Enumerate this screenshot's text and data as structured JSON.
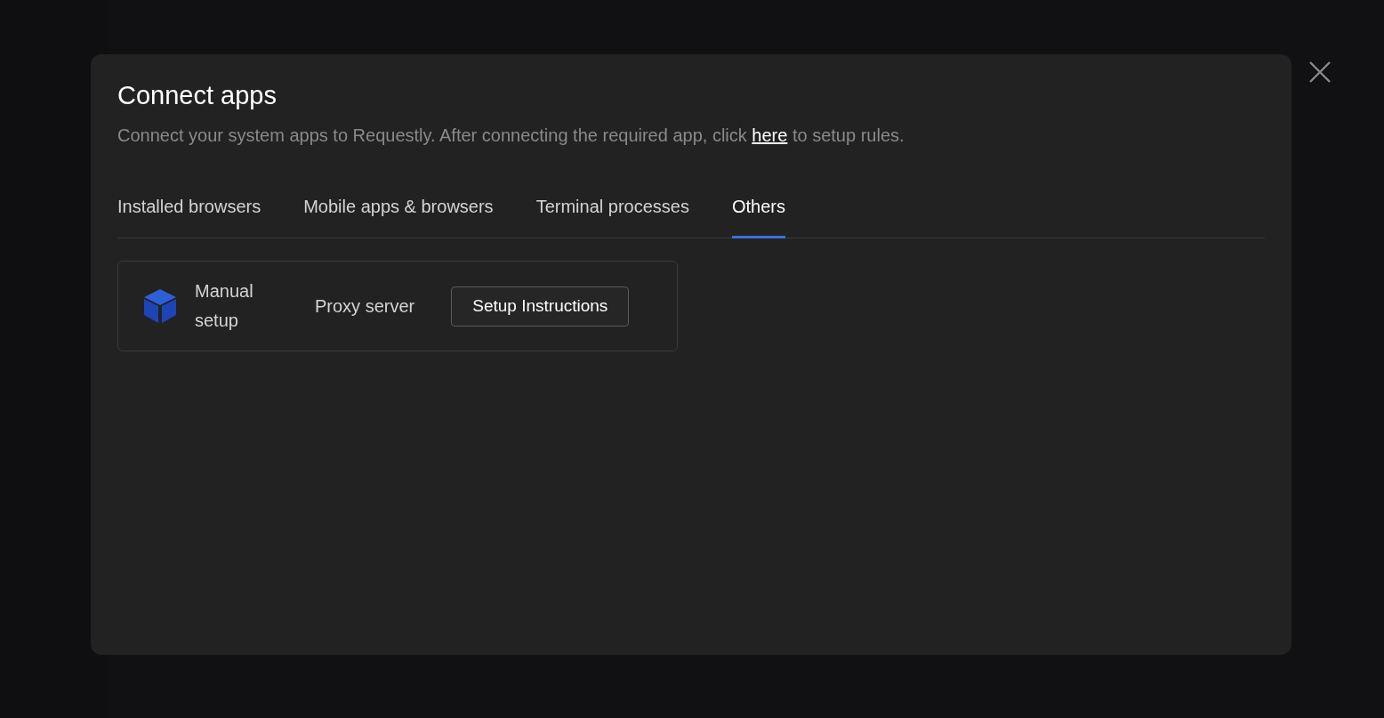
{
  "dialog": {
    "title": "Connect apps",
    "description": {
      "before": "Connect your system apps to Requestly. After connecting the required app, click ",
      "link": "here",
      "after": " to setup rules."
    }
  },
  "tabs": [
    {
      "label": "Installed browsers",
      "selected": false
    },
    {
      "label": "Mobile apps & browsers",
      "selected": false
    },
    {
      "label": "Terminal processes",
      "selected": false
    },
    {
      "label": "Others",
      "selected": true
    }
  ],
  "apps": [
    {
      "name": "Manual setup",
      "type": "Proxy server",
      "action": "Setup Instructions"
    }
  ]
}
